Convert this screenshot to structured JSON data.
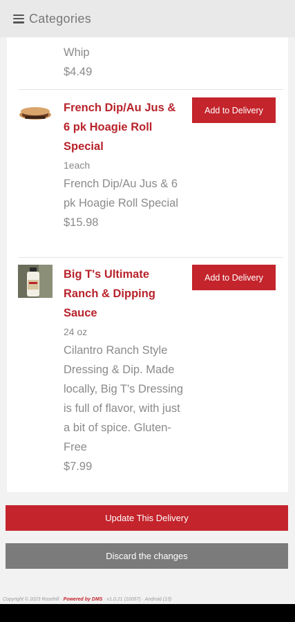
{
  "header": {
    "title": "Categories",
    "menu_icon": "hamburger-menu-icon"
  },
  "items": [
    {
      "desc": "Whip",
      "price": "$4.49"
    },
    {
      "name": "French Dip/Au Jus & 6 pk Hoagie Roll Special",
      "size": "1each",
      "desc": "French Dip/Au Jus & 6 pk Hoagie Roll Special",
      "price": "$15.98",
      "button": "Add to Delivery"
    },
    {
      "name": "Big T's Ultimate Ranch & Dipping Sauce",
      "size": "24 oz",
      "desc": "Cilantro Ranch Style Dressing & Dip. Made locally, Big T's Dressing is full of flavor, with just a bit of spice. Gluten-Free",
      "price": "$7.99",
      "button": "Add to Delivery"
    }
  ],
  "actions": {
    "update": "Update This Delivery",
    "discard": "Discard the changes"
  },
  "footer": {
    "copyright": "Copyright © 2023 Rosehill · ",
    "powered": "Powered by DMS",
    "version": " · v1.0.21 (10057) · Android (13)"
  },
  "colors": {
    "accent": "#c4242c",
    "secondary_button": "#7b7b7b"
  }
}
